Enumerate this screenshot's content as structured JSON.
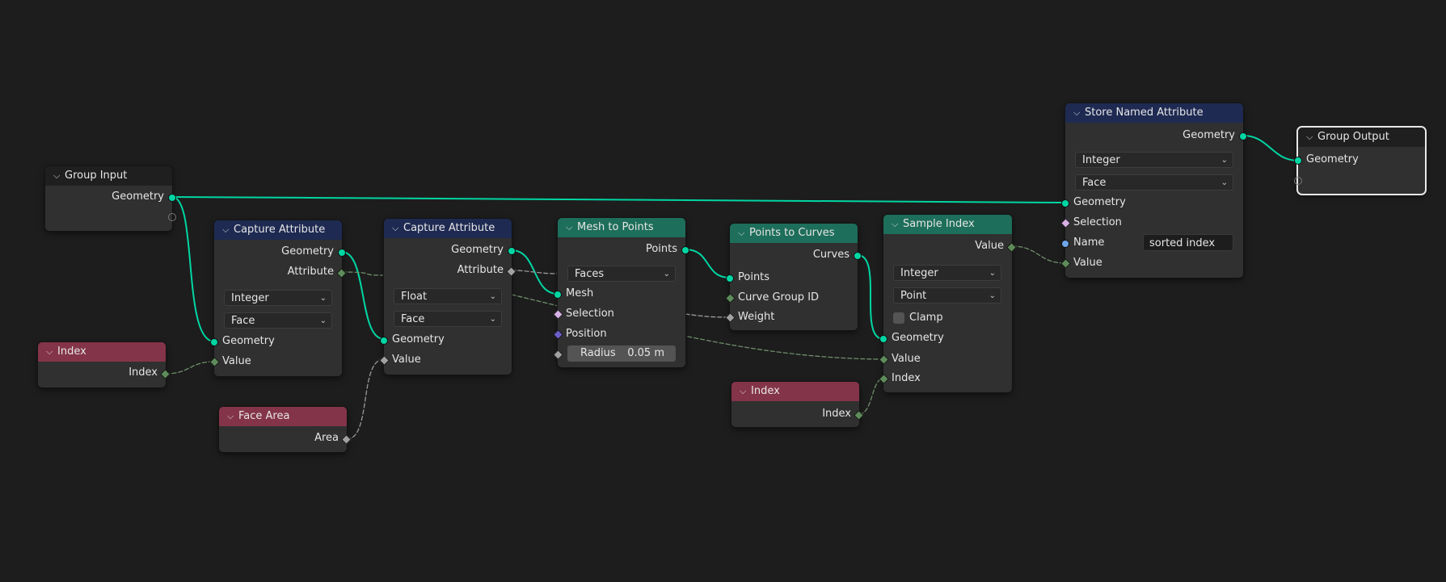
{
  "nodes": {
    "group_input": {
      "title": "Group Input",
      "geometry": "Geometry"
    },
    "capture1": {
      "title": "Capture Attribute",
      "out_geometry": "Geometry",
      "out_attribute": "Attribute",
      "data_type": "Integer",
      "domain": "Face",
      "in_geometry": "Geometry",
      "in_value": "Value"
    },
    "capture2": {
      "title": "Capture Attribute",
      "out_geometry": "Geometry",
      "out_attribute": "Attribute",
      "data_type": "Float",
      "domain": "Face",
      "in_geometry": "Geometry",
      "in_value": "Value"
    },
    "mesh_to_points": {
      "title": "Mesh to Points",
      "out_points": "Points",
      "mode": "Faces",
      "in_mesh": "Mesh",
      "in_selection": "Selection",
      "in_position": "Position",
      "radius_label": "Radius",
      "radius_value": "0.05 m"
    },
    "points_to_curves": {
      "title": "Points to Curves",
      "out_curves": "Curves",
      "in_points": "Points",
      "in_curve_group": "Curve Group ID",
      "in_weight": "Weight"
    },
    "sample_index": {
      "title": "Sample Index",
      "out_value": "Value",
      "data_type": "Integer",
      "domain": "Point",
      "clamp": "Clamp",
      "in_geometry": "Geometry",
      "in_value": "Value",
      "in_index": "Index"
    },
    "store_named": {
      "title": "Store Named Attribute",
      "out_geometry": "Geometry",
      "data_type": "Integer",
      "domain": "Face",
      "in_geometry": "Geometry",
      "in_selection": "Selection",
      "in_name": "Name",
      "name_value": "sorted index",
      "in_value": "Value"
    },
    "group_output": {
      "title": "Group Output",
      "geometry": "Geometry"
    },
    "index1": {
      "title": "Index",
      "out_index": "Index"
    },
    "face_area": {
      "title": "Face Area",
      "out_area": "Area"
    },
    "index2": {
      "title": "Index",
      "out_index": "Index"
    }
  },
  "colors": {
    "background": "#1d1d1d",
    "node_body": "#303030",
    "header_input_output": "#1f1f1f",
    "header_attribute": "#1e2a52",
    "header_geometry": "#1d6e5a",
    "header_input": "#843449",
    "geometry_socket": "#00d6a3",
    "field_wire": "#7a9a76"
  }
}
